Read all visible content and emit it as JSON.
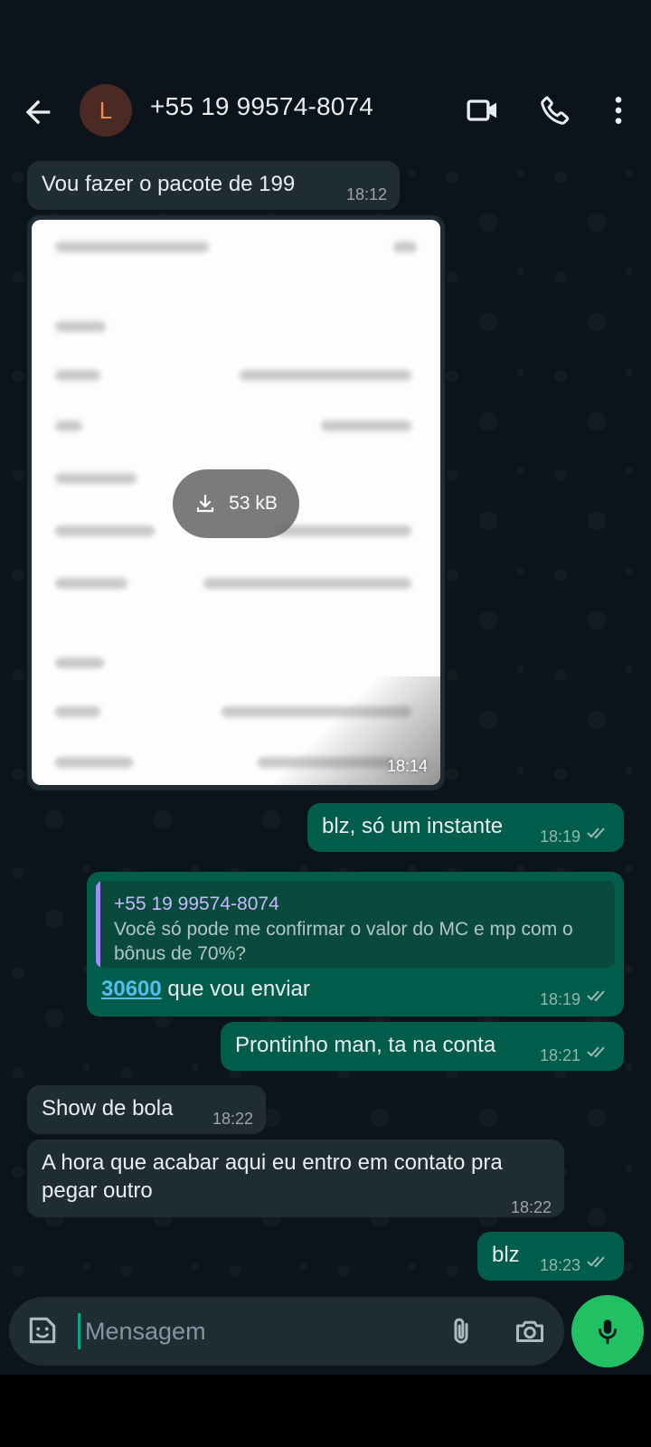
{
  "header": {
    "avatar_letter": "L",
    "contact_name": "+55 19 99574-8074"
  },
  "messages": [
    {
      "direction": "in",
      "text": "Vou fazer o pacote de 199",
      "time": "18:12"
    },
    {
      "direction": "in",
      "type": "document",
      "size": "53 kB",
      "time": "18:14"
    },
    {
      "direction": "out",
      "text": "blz, só um instante",
      "time": "18:19"
    },
    {
      "direction": "out",
      "type": "reply",
      "quote_author": "+55 19 99574-8074",
      "quote_text": "Você só pode me confirmar o valor do MC e mp com o bônus de 70%?",
      "link_text": "30600",
      "text": " que vou enviar",
      "time": "18:19"
    },
    {
      "direction": "out",
      "text": "Prontinho man, ta na conta",
      "time": "18:21"
    },
    {
      "direction": "in",
      "text": "Show de bola",
      "time": "18:22"
    },
    {
      "direction": "in",
      "text": "A hora que acabar aqui eu entro em contato pra pegar outro",
      "time": "18:22"
    },
    {
      "direction": "out",
      "text": "blz",
      "time": "18:23"
    }
  ],
  "composer": {
    "placeholder": "Mensagem"
  },
  "icons": {
    "back": "arrow-left-icon",
    "video": "video-call-icon",
    "call": "phone-icon",
    "more": "more-vert-icon",
    "emoji": "sticker-icon",
    "attach": "paperclip-icon",
    "camera": "camera-icon",
    "mic": "mic-icon",
    "download": "download-icon"
  },
  "colors": {
    "incoming_bubble": "#202c33",
    "outgoing_bubble": "#005c4b",
    "accent": "#21c063",
    "link": "#53bdeb"
  }
}
